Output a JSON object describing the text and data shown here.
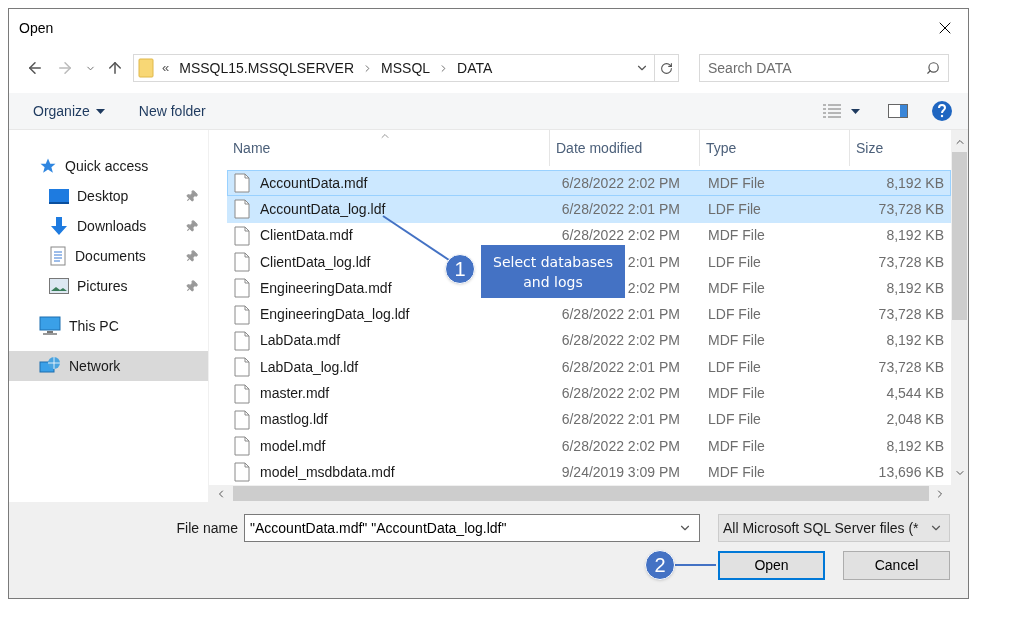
{
  "window": {
    "title": "Open"
  },
  "address": {
    "overflow": "«",
    "parts": [
      "MSSQL15.MSSQLSERVER",
      "MSSQL",
      "DATA"
    ]
  },
  "search": {
    "placeholder": "Search DATA"
  },
  "toolbar": {
    "items": [
      "Organize",
      "New folder"
    ]
  },
  "sidebar": {
    "items": [
      {
        "label": "Quick access",
        "selected": false,
        "children": [
          {
            "label": "Desktop",
            "pinned": true,
            "selected": false
          },
          {
            "label": "Downloads",
            "pinned": true,
            "selected": false
          },
          {
            "label": "Documents",
            "pinned": true,
            "selected": false
          },
          {
            "label": "Pictures",
            "pinned": true,
            "selected": false
          }
        ]
      },
      {
        "label": "This PC",
        "selected": false
      },
      {
        "label": "Network",
        "selected": true
      }
    ]
  },
  "table": {
    "columns": [
      "Name",
      "Date modified",
      "Type",
      "Size"
    ],
    "rows": [
      {
        "name": "AccountData.mdf",
        "date": "6/28/2022 2:02 PM",
        "type": "MDF File",
        "size": "8,192 KB",
        "selected": true
      },
      {
        "name": "AccountData_log.ldf",
        "date": "6/28/2022 2:01 PM",
        "type": "LDF File",
        "size": "73,728 KB",
        "selected": true
      },
      {
        "name": "ClientData.mdf",
        "date": "6/28/2022 2:02 PM",
        "type": "MDF File",
        "size": "8,192 KB",
        "selected": false
      },
      {
        "name": "ClientData_log.ldf",
        "date": "2:01 PM",
        "type": "LDF File",
        "size": "73,728 KB",
        "selected": false
      },
      {
        "name": "EngineeringData.mdf",
        "date": "2:02 PM",
        "type": "MDF File",
        "size": "8,192 KB",
        "selected": false
      },
      {
        "name": "EngineeringData_log.ldf",
        "date": "6/28/2022 2:01 PM",
        "type": "LDF File",
        "size": "73,728 KB",
        "selected": false
      },
      {
        "name": "LabData.mdf",
        "date": "6/28/2022 2:02 PM",
        "type": "MDF File",
        "size": "8,192 KB",
        "selected": false
      },
      {
        "name": "LabData_log.ldf",
        "date": "6/28/2022 2:01 PM",
        "type": "LDF File",
        "size": "73,728 KB",
        "selected": false
      },
      {
        "name": "master.mdf",
        "date": "6/28/2022 2:02 PM",
        "type": "MDF File",
        "size": "4,544 KB",
        "selected": false
      },
      {
        "name": "mastlog.ldf",
        "date": "6/28/2022 2:01 PM",
        "type": "LDF File",
        "size": "2,048 KB",
        "selected": false
      },
      {
        "name": "model.mdf",
        "date": "6/28/2022 2:02 PM",
        "type": "MDF File",
        "size": "8,192 KB",
        "selected": false
      },
      {
        "name": "model_msdbdata.mdf",
        "date": "9/24/2019 3:09 PM",
        "type": "MDF File",
        "size": "13,696 KB",
        "selected": false
      }
    ]
  },
  "file_name": {
    "label": "File name",
    "value": "\"AccountData.mdf\" \"AccountData_log.ldf\""
  },
  "filter": {
    "value": "All Microsoft SQL Server files (*"
  },
  "buttons": [
    {
      "label": "Open",
      "selected": true
    },
    {
      "label": "Cancel",
      "selected": false
    }
  ],
  "callouts": [
    {
      "number": "1",
      "text": "Select databases and logs"
    },
    {
      "number": "2"
    }
  ]
}
